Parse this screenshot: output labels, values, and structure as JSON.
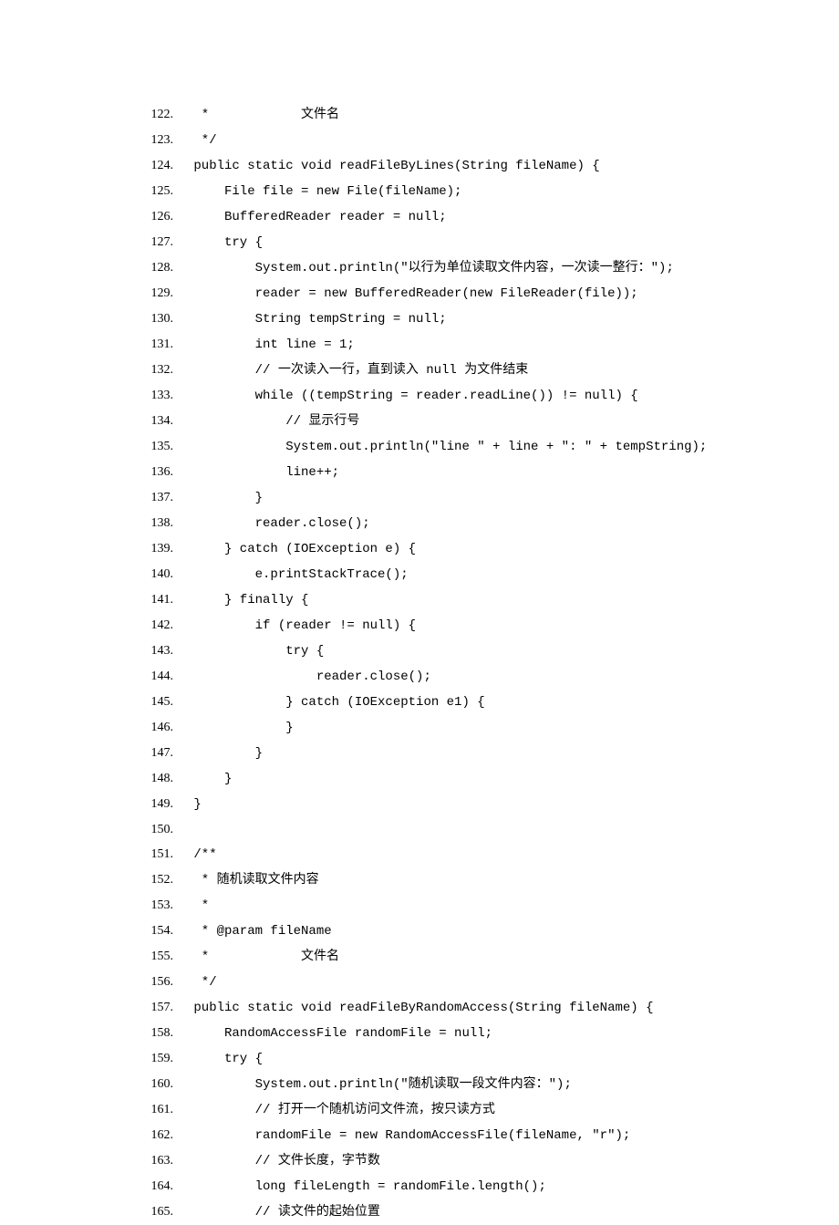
{
  "lines": [
    {
      "n": "122.",
      "t": "  *            文件名"
    },
    {
      "n": "123.",
      "t": "  */"
    },
    {
      "n": "124.",
      "t": " public static void readFileByLines(String fileName) {"
    },
    {
      "n": "125.",
      "t": "     File file = new File(fileName);"
    },
    {
      "n": "126.",
      "t": "     BufferedReader reader = null;"
    },
    {
      "n": "127.",
      "t": "     try {"
    },
    {
      "n": "128.",
      "t": "         System.out.println(\"以行为单位读取文件内容，一次读一整行：\");"
    },
    {
      "n": "129.",
      "t": "         reader = new BufferedReader(new FileReader(file));"
    },
    {
      "n": "130.",
      "t": "         String tempString = null;"
    },
    {
      "n": "131.",
      "t": "         int line = 1;"
    },
    {
      "n": "132.",
      "t": "         // 一次读入一行，直到读入 null 为文件结束"
    },
    {
      "n": "133.",
      "t": "         while ((tempString = reader.readLine()) != null) {"
    },
    {
      "n": "134.",
      "t": "             // 显示行号"
    },
    {
      "n": "135.",
      "t": "             System.out.println(\"line \" + line + \": \" + tempString);"
    },
    {
      "n": "136.",
      "t": "             line++;"
    },
    {
      "n": "137.",
      "t": "         }"
    },
    {
      "n": "138.",
      "t": "         reader.close();"
    },
    {
      "n": "139.",
      "t": "     } catch (IOException e) {"
    },
    {
      "n": "140.",
      "t": "         e.printStackTrace();"
    },
    {
      "n": "141.",
      "t": "     } finally {"
    },
    {
      "n": "142.",
      "t": "         if (reader != null) {"
    },
    {
      "n": "143.",
      "t": "             try {"
    },
    {
      "n": "144.",
      "t": "                 reader.close();"
    },
    {
      "n": "145.",
      "t": "             } catch (IOException e1) {"
    },
    {
      "n": "146.",
      "t": "             }"
    },
    {
      "n": "147.",
      "t": "         }"
    },
    {
      "n": "148.",
      "t": "     }"
    },
    {
      "n": "149.",
      "t": " }"
    },
    {
      "n": "150.",
      "t": ""
    },
    {
      "n": "151.",
      "t": " /**"
    },
    {
      "n": "152.",
      "t": "  * 随机读取文件内容"
    },
    {
      "n": "153.",
      "t": "  *"
    },
    {
      "n": "154.",
      "t": "  * @param fileName"
    },
    {
      "n": "155.",
      "t": "  *            文件名"
    },
    {
      "n": "156.",
      "t": "  */"
    },
    {
      "n": "157.",
      "t": " public static void readFileByRandomAccess(String fileName) {"
    },
    {
      "n": "158.",
      "t": "     RandomAccessFile randomFile = null;"
    },
    {
      "n": "159.",
      "t": "     try {"
    },
    {
      "n": "160.",
      "t": "         System.out.println(\"随机读取一段文件内容：\");"
    },
    {
      "n": "161.",
      "t": "         // 打开一个随机访问文件流，按只读方式"
    },
    {
      "n": "162.",
      "t": "         randomFile = new RandomAccessFile(fileName, \"r\");"
    },
    {
      "n": "163.",
      "t": "         // 文件长度，字节数"
    },
    {
      "n": "164.",
      "t": "         long fileLength = randomFile.length();"
    },
    {
      "n": "165.",
      "t": "         // 读文件的起始位置"
    }
  ]
}
